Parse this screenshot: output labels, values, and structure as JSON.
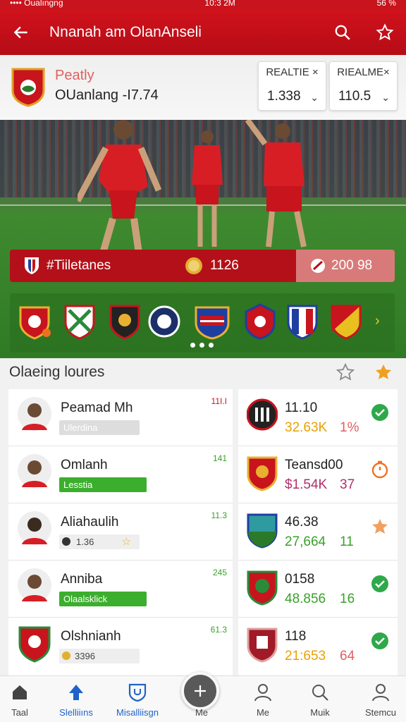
{
  "status": {
    "left": "•••• Oualıngng",
    "time": "10:3 2M",
    "right": "56 %"
  },
  "header": {
    "title": "Nnanah am OlanAnseli"
  },
  "match": {
    "penalty_label": "Peatly",
    "line": "OUanlang -I7.74",
    "pills": [
      {
        "label": "REALTIE ×",
        "value": "1.338"
      },
      {
        "label": "RIEALME×",
        "value": "110.5"
      }
    ]
  },
  "hero": {
    "stat_left": "#Tiiletanes",
    "stat_mid": "1126",
    "stat_right": "200 98"
  },
  "section": {
    "title": "Olaeing loures"
  },
  "players": [
    {
      "name": "Peamad Mh",
      "num": "11I.I",
      "sub": "Ulerdina",
      "sub_style": "grey"
    },
    {
      "name": "Omlanh",
      "num": "141",
      "sub": "Lesstia",
      "sub_style": "green"
    },
    {
      "name": "Aliahaulih",
      "num": "11.3",
      "sub": "1.36",
      "sub_style": "light"
    },
    {
      "name": "Anniba",
      "num": "245",
      "sub": "Olaalsklick",
      "sub_style": "green"
    },
    {
      "name": "Olshnianh",
      "num": "61.3",
      "sub": "3396",
      "sub_style": "light"
    }
  ],
  "teams": [
    {
      "top": "11.10",
      "a": "32.63K",
      "b": "1%",
      "a_color": "#e8a200",
      "b_color": "#e06060",
      "icon": "check-icon"
    },
    {
      "top": "Teansd00",
      "a": "$1.54K",
      "b": "37",
      "a_color": "#b0306b",
      "b_color": "#b0306b",
      "icon": "timer-icon"
    },
    {
      "top": "46.38",
      "a": "27,664",
      "b": "11",
      "a_color": "#3aa12a",
      "b_color": "#3aa12a",
      "icon": "star-badge-icon"
    },
    {
      "top": "0158",
      "a": "48.856",
      "b": "16",
      "a_color": "#3aa12a",
      "b_color": "#3aa12a",
      "icon": "check-icon"
    },
    {
      "top": "118",
      "a": "21:653",
      "b": "64",
      "a_color": "#e8a200",
      "b_color": "#e06060",
      "icon": "check-icon"
    }
  ],
  "nav": [
    {
      "label": "Taal"
    },
    {
      "label": "Slelliiıns"
    },
    {
      "label": "Misalliisgn"
    },
    {
      "label": "Me"
    },
    {
      "label": "Me"
    },
    {
      "label": "Muik"
    },
    {
      "label": "Stemcu"
    }
  ],
  "colors": {
    "primary": "#c8141d",
    "accent_green": "#3aa12a",
    "accent_blue": "#1f62c9"
  }
}
